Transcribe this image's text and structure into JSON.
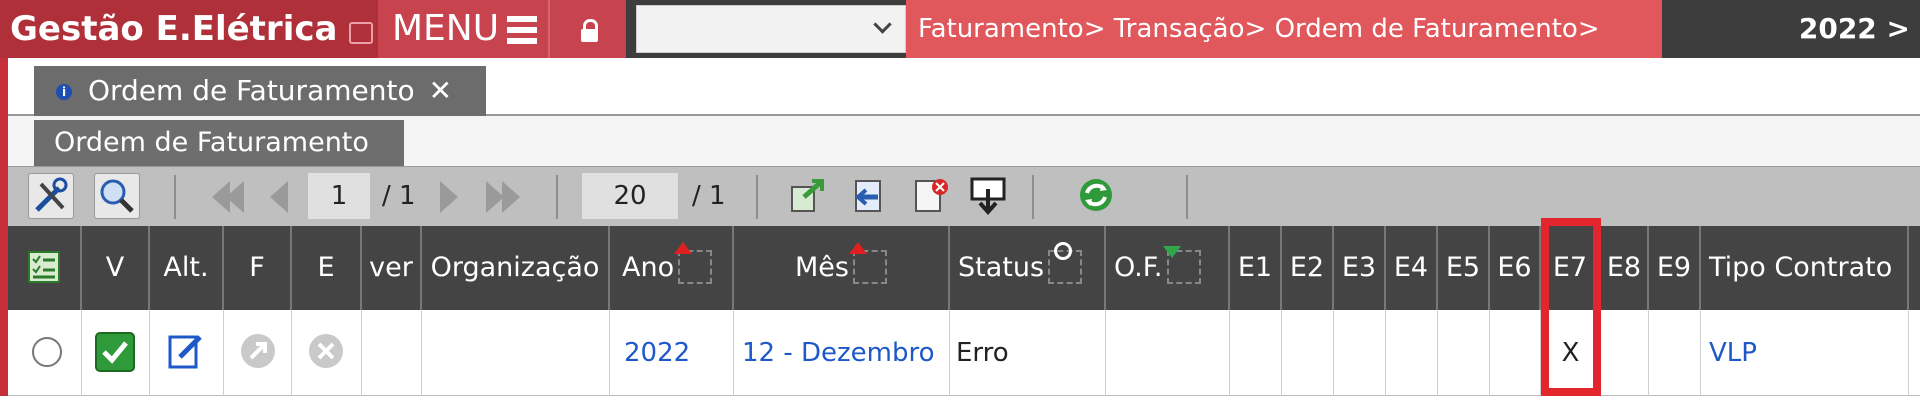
{
  "topbar": {
    "app_title": "Gestão E.Elétrica",
    "menu_label": "MENU",
    "breadcrumb": "Faturamento> Transação> Ordem de Faturamento>",
    "year_crumb": "2022 >"
  },
  "tabs": {
    "main_tab_label": "Ordem de Faturamento",
    "sub_title": "Ordem de Faturamento"
  },
  "toolbar": {
    "page_current": "1",
    "page_total": "/ 1",
    "page_size": "20",
    "page_size_total": "/ 1"
  },
  "table": {
    "columns": [
      "V",
      "Alt.",
      "F",
      "E",
      "ver",
      "Organização",
      "Ano",
      "Mês",
      "Status",
      "O.F.",
      "E1",
      "E2",
      "E3",
      "E4",
      "E5",
      "E6",
      "E7",
      "E8",
      "E9",
      "Tipo Contrato"
    ],
    "row": {
      "organizacao": "",
      "ano": "2022",
      "mes": "12 - Dezembro",
      "status": "Erro",
      "of": "",
      "e7": "X",
      "tipo_contrato": "VLP"
    }
  },
  "colors": {
    "brand": "#b0303a",
    "breadcrumb_bg": "#e0575c",
    "highlight": "#e3262d",
    "link": "#1f58c9"
  },
  "icons": [
    "tools-icon",
    "search-icon",
    "first-page-icon",
    "prev-page-icon",
    "next-page-icon",
    "last-page-icon",
    "export-icon",
    "import-icon",
    "pdf-icon",
    "download-icon",
    "refresh-icon"
  ]
}
